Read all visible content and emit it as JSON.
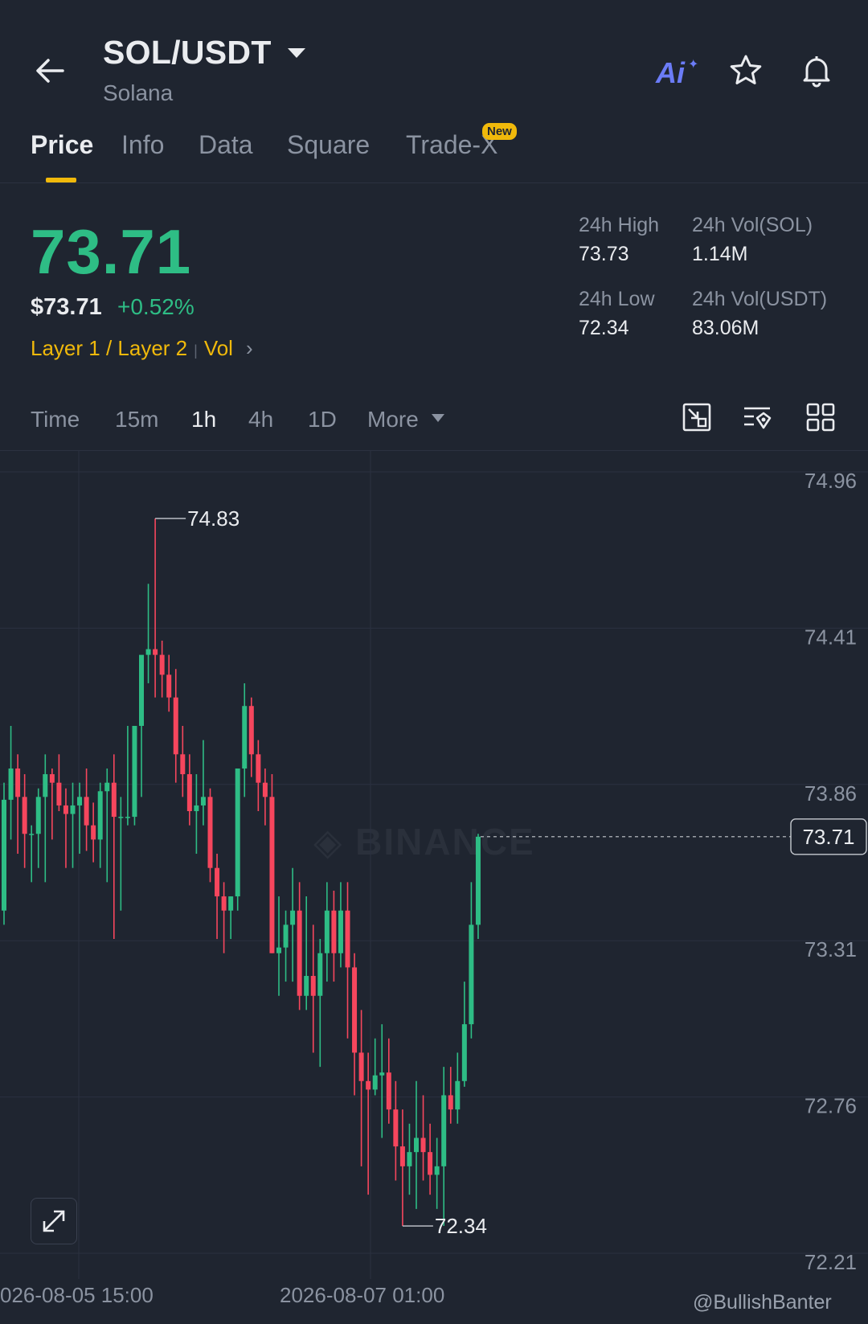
{
  "header": {
    "pair": "SOL/USDT",
    "name": "Solana",
    "ai_label": "Ai"
  },
  "tabs": [
    {
      "label": "Price",
      "active": true
    },
    {
      "label": "Info"
    },
    {
      "label": "Data"
    },
    {
      "label": "Square"
    },
    {
      "label": "Trade-X",
      "badge": "New"
    }
  ],
  "price": {
    "last": "73.71",
    "fiat": "$73.71",
    "change": "+0.52%",
    "tag": "Layer 1 / Layer 2",
    "tag2": "Vol"
  },
  "stats": {
    "high_label": "24h High",
    "high": "73.73",
    "low_label": "24h Low",
    "low": "72.34",
    "vol_sol_label": "24h Vol(SOL)",
    "vol_sol": "1.14M",
    "vol_usdt_label": "24h Vol(USDT)",
    "vol_usdt": "83.06M"
  },
  "intervals": {
    "time": "Time",
    "m15": "15m",
    "h1": "1h",
    "h4": "4h",
    "d1": "1D",
    "more": "More",
    "active": "1h"
  },
  "colors": {
    "up": "#2ebd85",
    "down": "#f6465d",
    "accent": "#f0b90b",
    "bg": "#1f2530"
  },
  "chart_data": {
    "type": "candlestick",
    "interval": "1h",
    "y_ticks": [
      "74.96",
      "74.41",
      "73.86",
      "73.31",
      "72.76",
      "72.21"
    ],
    "ylim": [
      72.21,
      74.96
    ],
    "x_ticks": [
      "026-08-05 15:00",
      "2026-08-07 01:00"
    ],
    "current_price_label": "73.71",
    "high_marker": "74.83",
    "low_marker": "72.34",
    "candles": [
      [
        73.45,
        73.9,
        73.4,
        73.84
      ],
      [
        73.84,
        74.1,
        73.7,
        73.95
      ],
      [
        73.95,
        74.0,
        73.65,
        73.85
      ],
      [
        73.85,
        73.93,
        73.6,
        73.72
      ],
      [
        73.72,
        73.75,
        73.55,
        73.72
      ],
      [
        73.72,
        73.88,
        73.6,
        73.85
      ],
      [
        73.85,
        74.0,
        73.55,
        73.93
      ],
      [
        73.93,
        73.95,
        73.7,
        73.9
      ],
      [
        73.9,
        74.0,
        73.8,
        73.82
      ],
      [
        73.82,
        73.88,
        73.6,
        73.79
      ],
      [
        73.79,
        73.9,
        73.6,
        73.82
      ],
      [
        73.82,
        73.9,
        73.65,
        73.85
      ],
      [
        73.85,
        73.95,
        73.66,
        73.75
      ],
      [
        73.75,
        73.83,
        73.62,
        73.7
      ],
      [
        73.7,
        73.9,
        73.6,
        73.87
      ],
      [
        73.87,
        73.95,
        73.55,
        73.9
      ],
      [
        73.9,
        74.0,
        73.35,
        73.78
      ],
      [
        73.78,
        73.85,
        73.45,
        73.78
      ],
      [
        73.78,
        74.1,
        73.75,
        73.78
      ],
      [
        73.78,
        74.05,
        73.75,
        74.1
      ],
      [
        74.1,
        74.3,
        73.85,
        74.35
      ],
      [
        74.35,
        74.6,
        74.25,
        74.37
      ],
      [
        74.37,
        74.83,
        74.2,
        74.35
      ],
      [
        74.35,
        74.4,
        74.2,
        74.28
      ],
      [
        74.28,
        74.35,
        74.15,
        74.2
      ],
      [
        74.2,
        74.3,
        73.9,
        74.0
      ],
      [
        74.0,
        74.1,
        73.85,
        73.93
      ],
      [
        73.93,
        74.0,
        73.75,
        73.8
      ],
      [
        73.8,
        73.93,
        73.65,
        73.82
      ],
      [
        73.82,
        74.05,
        73.75,
        73.85
      ],
      [
        73.85,
        73.88,
        73.55,
        73.6
      ],
      [
        73.6,
        73.65,
        73.35,
        73.5
      ],
      [
        73.5,
        73.55,
        73.3,
        73.45
      ],
      [
        73.45,
        73.5,
        73.35,
        73.5
      ],
      [
        73.5,
        73.95,
        73.45,
        73.95
      ],
      [
        73.95,
        74.25,
        73.85,
        74.17
      ],
      [
        74.17,
        74.2,
        73.92,
        74.0
      ],
      [
        74.0,
        74.05,
        73.8,
        73.9
      ],
      [
        73.9,
        73.95,
        73.75,
        73.85
      ],
      [
        73.85,
        73.93,
        73.3,
        73.3
      ],
      [
        73.3,
        73.5,
        73.15,
        73.32
      ],
      [
        73.32,
        73.45,
        73.2,
        73.4
      ],
      [
        73.4,
        73.6,
        73.2,
        73.45
      ],
      [
        73.45,
        73.55,
        73.1,
        73.15
      ],
      [
        73.15,
        73.5,
        73.1,
        73.22
      ],
      [
        73.22,
        73.4,
        72.95,
        73.15
      ],
      [
        73.15,
        73.35,
        72.9,
        73.3
      ],
      [
        73.3,
        73.55,
        73.2,
        73.45
      ],
      [
        73.45,
        73.52,
        73.2,
        73.3
      ],
      [
        73.3,
        73.55,
        73.25,
        73.45
      ],
      [
        73.45,
        73.55,
        73.0,
        73.25
      ],
      [
        73.25,
        73.3,
        72.8,
        72.95
      ],
      [
        72.95,
        73.1,
        72.55,
        72.85
      ],
      [
        72.85,
        72.95,
        72.45,
        72.82
      ],
      [
        72.82,
        73.0,
        72.8,
        72.87
      ],
      [
        72.87,
        73.05,
        72.65,
        72.88
      ],
      [
        72.88,
        73.0,
        72.7,
        72.75
      ],
      [
        72.75,
        72.85,
        72.5,
        72.62
      ],
      [
        72.62,
        72.75,
        72.34,
        72.55
      ],
      [
        72.55,
        72.7,
        72.45,
        72.6
      ],
      [
        72.6,
        72.85,
        72.4,
        72.65
      ],
      [
        72.65,
        72.8,
        72.5,
        72.6
      ],
      [
        72.6,
        72.7,
        72.45,
        72.52
      ],
      [
        72.52,
        72.65,
        72.4,
        72.55
      ],
      [
        72.55,
        72.9,
        72.34,
        72.8
      ],
      [
        72.8,
        72.9,
        72.7,
        72.75
      ],
      [
        72.75,
        72.95,
        72.7,
        72.85
      ],
      [
        72.85,
        73.2,
        72.83,
        73.05
      ],
      [
        73.05,
        73.55,
        73.0,
        73.4
      ],
      [
        73.4,
        73.72,
        73.35,
        73.71
      ]
    ]
  },
  "footer": {
    "credit": "@BullishBanter"
  }
}
